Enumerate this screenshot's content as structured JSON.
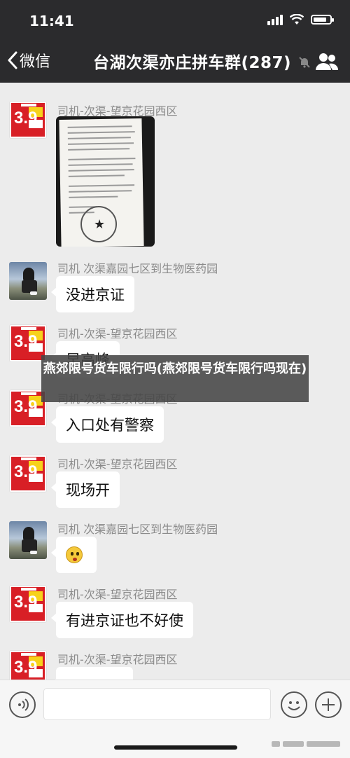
{
  "status_bar": {
    "time": "11:41"
  },
  "nav": {
    "back_label": "微信",
    "title": "台湖次渠亦庄拼车群(287)"
  },
  "messages": [
    {
      "sender": "司机-次渠-望京花园西区",
      "type": "image"
    },
    {
      "sender": "司机 次渠嘉园七区到生物医药园",
      "text": "没进京证"
    },
    {
      "sender": "司机-次渠-望京花园西区",
      "text": "早高峰"
    },
    {
      "sender": "司机-次渠-望京花园西区",
      "text": "入口处有警察"
    },
    {
      "sender": "司机-次渠-望京花园西区",
      "text": "现场开"
    },
    {
      "sender": "司机 次渠嘉园七区到生物医药园",
      "type": "emoji"
    },
    {
      "sender": "司机-次渠-望京花园西区",
      "text": "有进京证也不好使"
    },
    {
      "sender": "司机-次渠-望京花园西区"
    }
  ],
  "avatar_price": "3.9",
  "banner": {
    "title": "燕郊限号货车限行吗(燕郊限号货车限行吗现在)"
  },
  "icons": {
    "back": "chevron-left-icon",
    "mute": "mute-bell-icon",
    "members": "people-icon",
    "voice": "voice-icon",
    "emoji": "smile-icon",
    "more": "plus-icon"
  },
  "colors": {
    "topbar": "#2b2b2d",
    "chat_bg": "#ececec",
    "avatar_red": "#d81f26"
  }
}
